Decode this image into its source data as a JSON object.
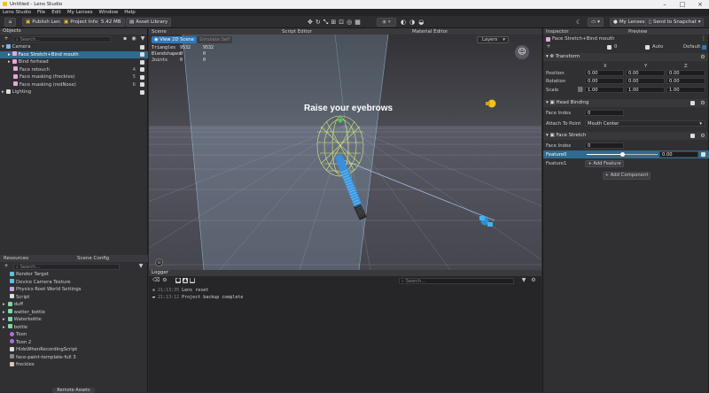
{
  "titlebar": {
    "title": "Untitled - Lens Studio"
  },
  "menu": [
    "Lens Studio",
    "File",
    "Edit",
    "My Lenses",
    "Window",
    "Help"
  ],
  "toolbar": {
    "publish": "Publish Lens",
    "project_info": "Project Info",
    "size": "5.42 MB",
    "asset_library": "Asset Library",
    "my_lenses": "My Lenses",
    "send": "Send to Snapchat"
  },
  "objects": {
    "title": "Objects",
    "search": "Search...",
    "items": [
      {
        "label": "Camera",
        "num": ""
      },
      {
        "label": "Face Stretch+Bind mouth",
        "num": ""
      },
      {
        "label": "Bind forhead",
        "num": ""
      },
      {
        "label": "Face retouch",
        "num": "4"
      },
      {
        "label": "Face masking (freckles)",
        "num": "5"
      },
      {
        "label": "Face masking (redNose)",
        "num": "6"
      },
      {
        "label": "Lighting",
        "num": ""
      }
    ]
  },
  "resources": {
    "tab1": "Resources",
    "tab2": "Scene Config",
    "search": "Search...",
    "items": [
      "Render Target",
      "Device Camera Texture",
      "Physics Root World Settings",
      "Script",
      "duff",
      "watter_bottle",
      "Waterbottle",
      "bottle",
      "Toon",
      "Toon 2",
      "HideWhenRecordingScript",
      "face-paint-template-full 3",
      "freckles"
    ],
    "bottom_button": "Remote Assets"
  },
  "scene": {
    "tab": "Scene",
    "script_tab": "Script Editor",
    "material_tab": "Material Editor",
    "view2d": "View 2D Scene",
    "safe": "Simulate Self",
    "layers": "Layers",
    "overlay_text": "Raise your eyebrows",
    "stats": [
      [
        "Triangles",
        "9532",
        "9532"
      ],
      [
        "Blendshapes",
        "0",
        "0"
      ],
      [
        "Joints",
        "0",
        "0"
      ]
    ]
  },
  "logger": {
    "title": "Logger",
    "search": "Search...",
    "lines": [
      {
        "time": "21:13:35",
        "msg": "Lens reset"
      },
      {
        "time": "21:13:12",
        "msg": "Project backup complete"
      }
    ]
  },
  "inspector": {
    "tab": "Inspector",
    "preview": "Preview",
    "object_name": "Face Stretch+Bind mouth",
    "layer": "0",
    "auto": "Auto",
    "default": "Default",
    "transform": {
      "title": "Transform",
      "axes": [
        "X",
        "Y",
        "Z"
      ],
      "rows": [
        {
          "label": "Position",
          "v": [
            "0.00",
            "0.00",
            "0.00"
          ]
        },
        {
          "label": "Rotation",
          "v": [
            "0.00",
            "0.00",
            "0.00"
          ]
        },
        {
          "label": "Scale",
          "v": [
            "1.00",
            "1.00",
            "1.00"
          ]
        }
      ]
    },
    "head_binding": {
      "title": "Head Binding",
      "face_index_label": "Face Index",
      "face_index": "0",
      "attach_label": "Attach To Point",
      "attach": "Mouth Center"
    },
    "face_stretch": {
      "title": "Face Stretch",
      "face_index_label": "Face Index",
      "face_index": "0",
      "feature0_label": "Feature0",
      "feature0": "0.00",
      "feature0_level": 0.5,
      "feature1_label": "Feature1",
      "add_feature": "Add Feature"
    },
    "add_component": "Add Component"
  }
}
